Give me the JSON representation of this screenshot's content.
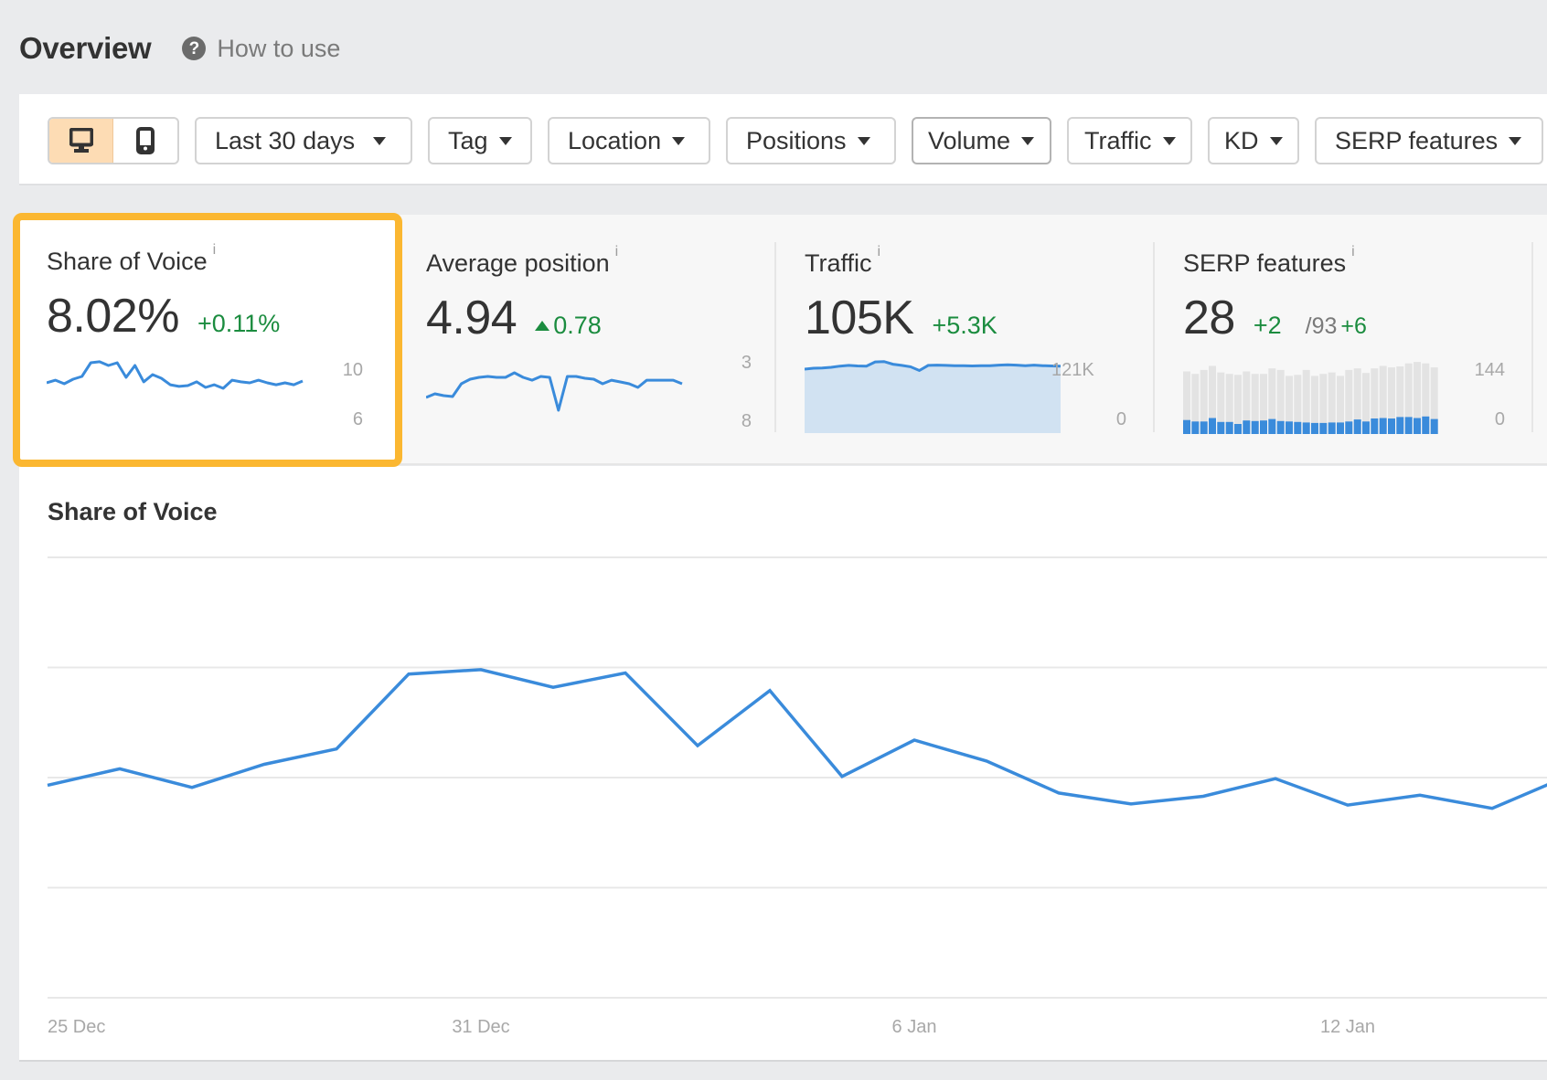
{
  "header": {
    "title": "Overview",
    "help_icon": "question-circle-icon",
    "help_label": "How to use"
  },
  "filters": {
    "device_toggle": [
      {
        "name": "desktop",
        "icon": "desktop-icon",
        "active": true
      },
      {
        "name": "mobile",
        "icon": "mobile-icon",
        "active": false
      }
    ],
    "date_range": "Last 30 days",
    "tag": "Tag",
    "location": "Location",
    "positions": "Positions",
    "volume": "Volume",
    "traffic": "Traffic",
    "kd": "KD",
    "serp_features": "SERP features"
  },
  "cards": {
    "share_of_voice": {
      "title": "Share of Voice",
      "info": "i",
      "value": "8.02%",
      "delta": "+0.11%",
      "axis_max": "10",
      "axis_min": "6",
      "highlighted": true,
      "sparkline": [
        8.22,
        8.44,
        8.15,
        8.52,
        8.74,
        9.85,
        9.93,
        9.63,
        9.85,
        8.67,
        9.63,
        8.3,
        8.89,
        8.59,
        8.07,
        7.93,
        8.0,
        8.3,
        7.85,
        8.07,
        7.78,
        8.44,
        8.3,
        8.22,
        8.44,
        8.22,
        8.07,
        8.22,
        8.07,
        8.37
      ]
    },
    "average_position": {
      "title": "Average position",
      "info": "i",
      "value": "4.94",
      "delta": "0.78",
      "delta_direction": "up",
      "axis_top": "3",
      "axis_bottom": "8",
      "sparkline": [
        5.5,
        5.19,
        5.34,
        5.42,
        4.33,
        3.94,
        3.78,
        3.7,
        3.78,
        3.78,
        3.39,
        3.78,
        4.02,
        3.7,
        3.78,
        6.59,
        3.7,
        3.7,
        3.86,
        3.94,
        4.33,
        4.02,
        4.17,
        4.33,
        4.64,
        4.02,
        4.02,
        4.02,
        4.02,
        4.33
      ]
    },
    "traffic": {
      "title": "Traffic",
      "info": "i",
      "value": "105K",
      "delta": "+5.3K",
      "axis_max": "121K",
      "axis_min": "0",
      "sparkline_k": [
        111.5,
        113,
        113.5,
        114.6,
        116.7,
        118,
        117,
        116.7,
        124,
        124.6,
        120,
        118,
        115.6,
        109,
        118,
        118.4,
        118,
        117.5,
        117.5,
        117,
        117.5,
        117.5,
        118.4,
        119,
        118.4,
        117.5,
        118.4,
        117.5,
        117,
        116.7
      ]
    },
    "serp_features": {
      "title": "SERP features",
      "info": "i",
      "value": "28",
      "delta": "+2",
      "total": "/93",
      "total_delta": "+6",
      "axis_max": "144",
      "axis_min": "0",
      "bars_total": [
        125,
        120,
        128,
        136,
        123,
        120,
        118,
        125,
        120,
        120,
        131,
        128,
        116,
        118,
        128,
        116,
        120,
        123,
        116,
        128,
        131,
        122,
        131,
        136,
        133,
        135,
        141,
        144,
        141,
        133
      ],
      "bars_owned": [
        28,
        25,
        25,
        32,
        24,
        24,
        20,
        27,
        26,
        27,
        30,
        26,
        25,
        24,
        23,
        22,
        22,
        23,
        23,
        25,
        29,
        25,
        31,
        32,
        31,
        34,
        34,
        32,
        35,
        30
      ]
    }
  },
  "chart": {
    "title": "Share of Voice"
  },
  "colors": {
    "accent_line": "#3a8bdb",
    "area_fill": "#d1e2f2",
    "highlight_border": "#fbb731",
    "positive": "#1b8c3f",
    "bar_gray": "#e3e3e3",
    "active_device": "#fddcb4"
  },
  "chart_data": {
    "type": "line",
    "title": "Share of Voice",
    "xlabel": "",
    "ylabel": "",
    "x": [
      "25 Dec",
      "26 Dec",
      "27 Dec",
      "28 Dec",
      "29 Dec",
      "30 Dec",
      "31 Dec",
      "1 Jan",
      "2 Jan",
      "3 Jan",
      "4 Jan",
      "5 Jan",
      "6 Jan",
      "7 Jan",
      "8 Jan",
      "9 Jan",
      "10 Jan",
      "11 Jan",
      "12 Jan",
      "13 Jan",
      "14 Jan",
      "15 Jan"
    ],
    "x_tick_labels": [
      "25 Dec",
      "31 Dec",
      "6 Jan",
      "12 Jan"
    ],
    "series": [
      {
        "name": "Share of Voice",
        "values": [
          7.93,
          8.08,
          7.91,
          8.12,
          8.26,
          8.94,
          8.98,
          8.82,
          8.95,
          8.29,
          8.79,
          8.01,
          8.34,
          8.15,
          7.86,
          7.76,
          7.83,
          7.99,
          7.75,
          7.84,
          7.72,
          8.0
        ]
      }
    ],
    "ylim": [
      6,
      10
    ],
    "y_gridlines": [
      6,
      7,
      8,
      9,
      10
    ],
    "grid": true,
    "legend": "none"
  }
}
